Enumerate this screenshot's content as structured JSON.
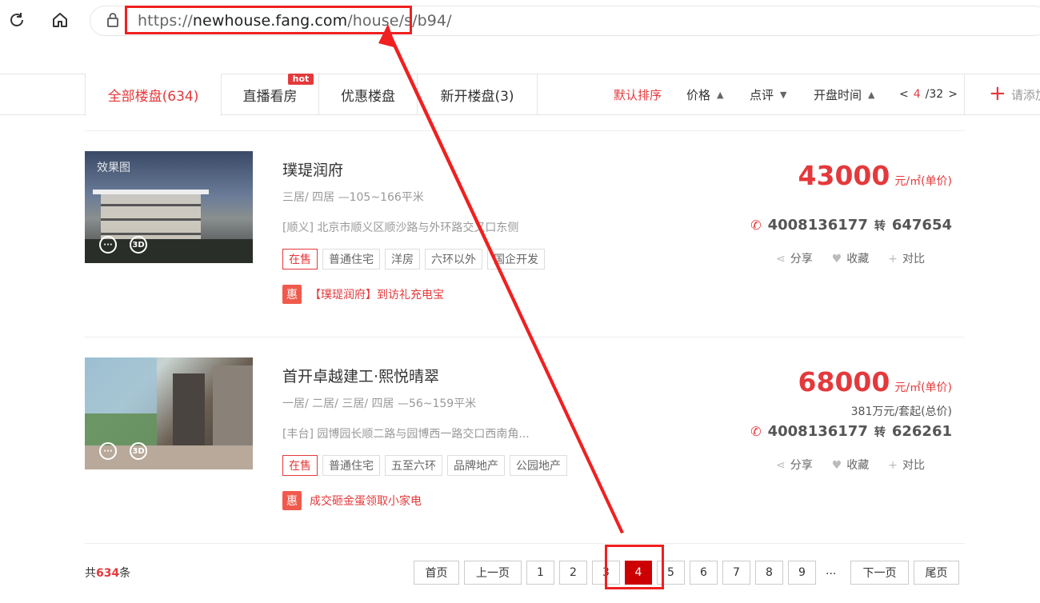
{
  "browser": {
    "url_scheme": "https://",
    "url_host": "newhouse.fang.com",
    "url_path": "/house/s/b94/"
  },
  "tabs": [
    {
      "label": "全部楼盘(634)",
      "active": true
    },
    {
      "label": "直播看房",
      "badge": "hot"
    },
    {
      "label": "优惠楼盘"
    },
    {
      "label": "新开楼盘(3)"
    }
  ],
  "sort": {
    "default": "默认排序",
    "price": "价格",
    "review": "点评",
    "open_time": "开盘时间"
  },
  "mini_pager": {
    "prev": "<",
    "current": "4",
    "total": "/32",
    "next": ">"
  },
  "add_button": "请添加",
  "listings": [
    {
      "image_label": "效果图",
      "name": "璞瑅润府",
      "rooms": "三居/ 四居 —105~166平米",
      "address": "[顺义] 北京市顺义区顺沙路与外环路交叉口东侧",
      "tags": [
        "在售",
        "普通住宅",
        "洋房",
        "六环以外",
        "国企开发"
      ],
      "promo": "【璞瑅润府】到访礼充电宝",
      "price": "43000",
      "price_unit": "元/㎡(单价)",
      "total_price": "",
      "phone": "4008136177",
      "ext": "647654"
    },
    {
      "image_label": "",
      "name": "首开卓越建工·熙悦晴翠",
      "rooms": "一居/ 二居/ 三居/ 四居 —56~159平米",
      "address": "[丰台] 园博园长顺二路与园博西一路交口西南角...",
      "tags": [
        "在售",
        "普通住宅",
        "五至六环",
        "品牌地产",
        "公园地产"
      ],
      "promo": "成交砸金蛋领取小家电",
      "price": "68000",
      "price_unit": "元/㎡(单价)",
      "total_price": "381万元/套起(总价)",
      "phone": "4008136177",
      "ext": "626261"
    }
  ],
  "actions": {
    "share": "分享",
    "favorite": "收藏",
    "compare": "对比",
    "zhuan": "转",
    "hui": "惠"
  },
  "pagination": {
    "total_prefix": "共",
    "total_count": "634",
    "total_suffix": "条",
    "first": "首页",
    "prev": "上一页",
    "pages": [
      "1",
      "2",
      "3",
      "4",
      "5",
      "6",
      "7",
      "8",
      "9"
    ],
    "current": "4",
    "ellipsis": "...",
    "next": "下一页",
    "last": "尾页"
  },
  "colors": {
    "accent": "#e4393c",
    "annotation": "#f02020"
  }
}
